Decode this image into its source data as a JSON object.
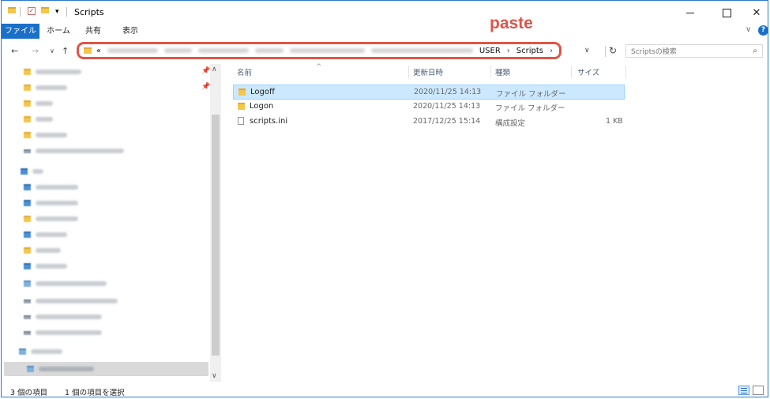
{
  "window": {
    "title": "Scripts",
    "quick_access_dropdown": "▾",
    "controls": {
      "minimize": "",
      "maximize": "",
      "close": "✕"
    }
  },
  "ribbon": {
    "tabs": [
      {
        "label": "ファイル",
        "active": true
      },
      {
        "label": "ホーム"
      },
      {
        "label": "共有"
      },
      {
        "label": "表示"
      }
    ],
    "collapse_glyph": "∨",
    "help_glyph": "?"
  },
  "annotation": {
    "text": "paste",
    "color": "#e0534a"
  },
  "navigation": {
    "back": "←",
    "forward": "→",
    "recent": "∨",
    "up": "↑",
    "address": {
      "overflow": "«",
      "crumbs_visible": [
        "USER",
        "Scripts"
      ],
      "chevron": "›",
      "highlight_color": "#e05545"
    },
    "address_dropdown": "∨",
    "refresh": "↻",
    "search_placeholder": "Scriptsの検索"
  },
  "columns": {
    "name": "名前",
    "modified": "更新日時",
    "type": "種類",
    "size": "サイズ"
  },
  "files": [
    {
      "name": "Logoff",
      "modified": "2020/11/25 14:13",
      "type": "ファイル フォルダー",
      "size": "",
      "icon": "folder-icon",
      "selected": true
    },
    {
      "name": "Logon",
      "modified": "2020/11/25 14:13",
      "type": "ファイル フォルダー",
      "size": "",
      "icon": "folder-icon",
      "selected": false
    },
    {
      "name": "scripts.ini",
      "modified": "2017/12/25 15:14",
      "type": "構成設定",
      "size": "1 KB",
      "icon": "settings-file-icon",
      "selected": false
    }
  ],
  "status": {
    "item_count": "3 個の項目",
    "selected_count": "1 個の項目を選択"
  },
  "colors": {
    "accent": "#1a70c8",
    "selection": "#cce8ff",
    "highlight_border": "#e05545"
  }
}
